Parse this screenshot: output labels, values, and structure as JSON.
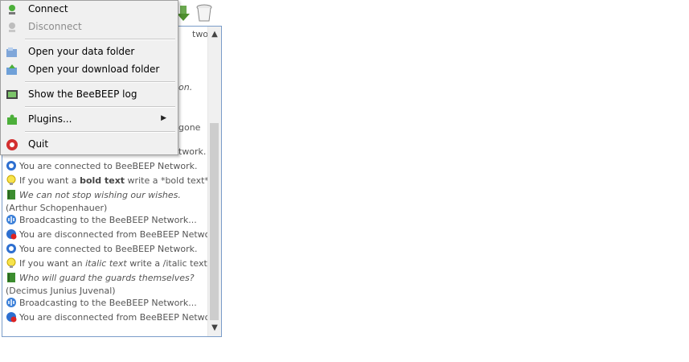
{
  "menu": {
    "connect": "Connect",
    "disconnect": "Disconnect",
    "open_data_folder": "Open your data folder",
    "open_download_folder": "Open your download folder",
    "show_log": "Show the BeeBEEP log",
    "plugins": "Plugins...",
    "quit": "Quit"
  },
  "chat": {
    "partial1": "twork.",
    "partial2": "on.",
    "partial3": "gone",
    "partial4": "twork.",
    "m1": "You are connected to BeeBEEP Network.",
    "m2a": "If you want a ",
    "m2b": "bold text",
    "m2c": " write a *bold text*.",
    "m3a": "We can not stop wishing our wishes.",
    "m3b": " (Arthur Schopenhauer)",
    "m4": "Broadcasting to the BeeBEEP Network...",
    "m5": "You are disconnected from BeeBEEP Network.",
    "m6": "You are connected to BeeBEEP Network.",
    "m7a": "If you want an ",
    "m7b": "italic text",
    "m7c": " write a /italic text/.",
    "m8a": "Who will guard the guards themselves?",
    "m8b": "(Decimus Junius Juvenal)",
    "m9": "Broadcasting to the BeeBEEP Network...",
    "m10": "You are disconnected from BeeBEEP Network."
  },
  "colors": {
    "panel_border": "#7a9cc9",
    "menu_bg": "#f0f0f0",
    "disabled_text": "#8c8c8c"
  }
}
